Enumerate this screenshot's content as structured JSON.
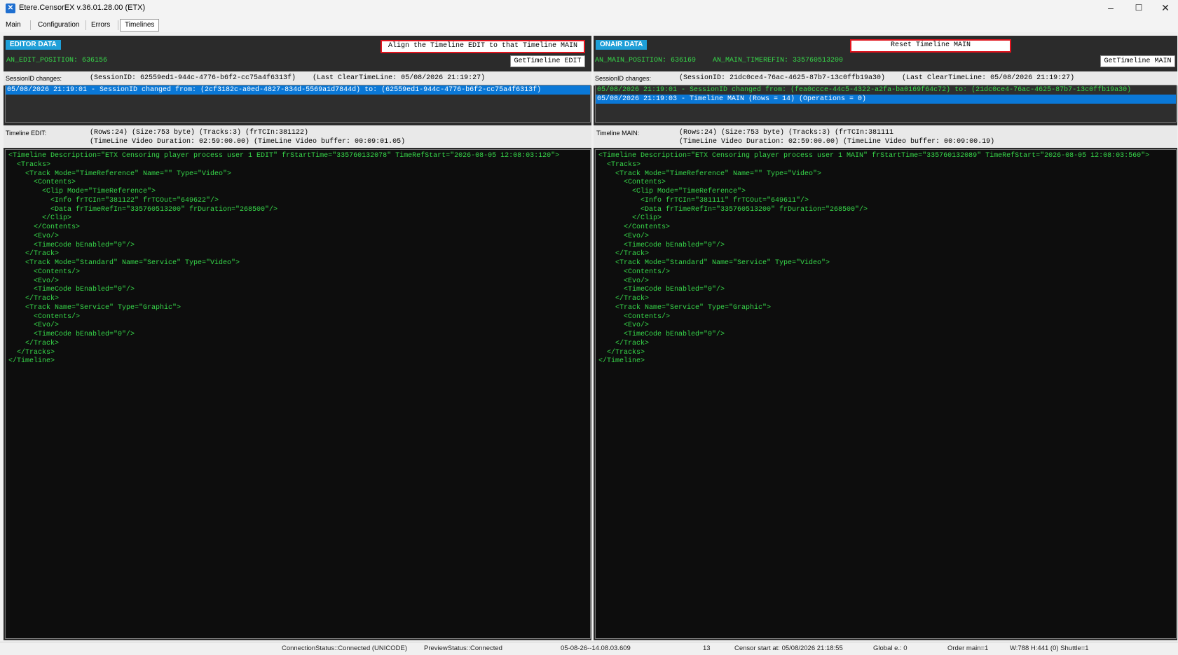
{
  "window": {
    "title": "Etere.CensorEX  v.36.01.28.00 (ETX)",
    "minimize": "–",
    "maximize": "☐",
    "close": "✕"
  },
  "tabs": [
    {
      "label": "Main"
    },
    {
      "label": "Configuration"
    },
    {
      "label": "Errors"
    },
    {
      "label": "Timelines",
      "selected": true
    }
  ],
  "editor": {
    "badge": "EDITOR DATA",
    "align_button": "Align the Timeline EDIT to that Timeline MAIN",
    "position": "AN_EDIT_POSITION: 636156",
    "get_button": "GetTimeline EDIT",
    "session_label": "SessionID changes:",
    "session_text": "(SessionID: 62559ed1-944c-4776-b6f2-cc75a4f6313f)    (Last ClearTimeLine: 05/08/2026 21:19:27)",
    "session_rows": [
      "05/08/2026 21:19:01 - SessionID changed from: (2cf3182c-a0ed-4827-834d-5569a1d7844d) to: (62559ed1-944c-4776-b6f2-cc75a4f6313f)"
    ],
    "timeline_label": "Timeline EDIT:",
    "timeline_line1": "(Rows:24) (Size:753 byte) (Tracks:3) (frTCIn:381122)",
    "timeline_line2": "(TimeLine Video Duration: 02:59:00.00) (TimeLine Video buffer: 00:09:01.05)",
    "xml": "<Timeline Description=\"ETX Censoring player process user 1 EDIT\" frStartTime=\"335760132078\" TimeRefStart=\"2026-08-05 12:08:03:120\">\n  <Tracks>\n    <Track Mode=\"TimeReference\" Name=\"\" Type=\"Video\">\n      <Contents>\n        <Clip Mode=\"TimeReference\">\n          <Info frTCIn=\"381122\" frTCOut=\"649622\"/>\n          <Data frTimeRefIn=\"335760513200\" frDuration=\"268500\"/>\n        </Clip>\n      </Contents>\n      <Evo/>\n      <TimeCode bEnabled=\"0\"/>\n    </Track>\n    <Track Mode=\"Standard\" Name=\"Service\" Type=\"Video\">\n      <Contents/>\n      <Evo/>\n      <TimeCode bEnabled=\"0\"/>\n    </Track>\n    <Track Name=\"Service\" Type=\"Graphic\">\n      <Contents/>\n      <Evo/>\n      <TimeCode bEnabled=\"0\"/>\n    </Track>\n  </Tracks>\n</Timeline>"
  },
  "onair": {
    "badge": "ONAIR DATA",
    "reset_button": "Reset Timeline MAIN",
    "position": "AN_MAIN_POSITION: 636169    AN_MAIN_TIMEREFIN: 335760513200",
    "get_button": "GetTimeline MAIN",
    "session_label": "SessionID changes:",
    "session_text": "(SessionID: 21dc0ce4-76ac-4625-87b7-13c0ffb19a30)    (Last ClearTimeLine: 05/08/2026 21:19:27)",
    "session_rows": [
      "05/08/2026 21:19:01 - SessionID changed from: (fea0ccce-44c5-4322-a2fa-ba0169f64c72) to: (21dc0ce4-76ac-4625-87b7-13c0ffb19a30)",
      "05/08/2026 21:19:03 - Timeline MAIN (Rows = 14) (Operations = 0)"
    ],
    "timeline_label": "Timeline MAIN:",
    "timeline_line1": "(Rows:24) (Size:753 byte) (Tracks:3) (frTCIn:381111",
    "timeline_line2": "(TimeLine Video Duration: 02:59:00.00) (TimeLine Video buffer: 00:09:00.19)",
    "xml": "<Timeline Description=\"ETX Censoring player process user 1 MAIN\" frStartTime=\"335760132089\" TimeRefStart=\"2026-08-05 12:08:03:560\">\n  <Tracks>\n    <Track Mode=\"TimeReference\" Name=\"\" Type=\"Video\">\n      <Contents>\n        <Clip Mode=\"TimeReference\">\n          <Info frTCIn=\"381111\" frTCOut=\"649611\"/>\n          <Data frTimeRefIn=\"335760513200\" frDuration=\"268500\"/>\n        </Clip>\n      </Contents>\n      <Evo/>\n      <TimeCode bEnabled=\"0\"/>\n    </Track>\n    <Track Mode=\"Standard\" Name=\"Service\" Type=\"Video\">\n      <Contents/>\n      <Evo/>\n      <TimeCode bEnabled=\"0\"/>\n    </Track>\n    <Track Name=\"Service\" Type=\"Graphic\">\n      <Contents/>\n      <Evo/>\n      <TimeCode bEnabled=\"0\"/>\n    </Track>\n  </Tracks>\n</Timeline>"
  },
  "status": {
    "connection": "ConnectionStatus::Connected (UNICODE)",
    "preview": "PreviewStatus::Connected",
    "datetime": "05-08-26--14.08.03.609",
    "count": "13",
    "censor_start": "Censor start at: 05/08/2026 21:18:55",
    "global": "Global e.: 0",
    "order": "Order main=1",
    "size": "W:788  H:441   (0) Shuttle=1"
  },
  "colors": {
    "panel_bg": "#2b2b2b",
    "accent": "#1e9fd8",
    "xml_text": "#37d94a",
    "selection": "#0a78d7",
    "button_border": "#e0141e"
  }
}
